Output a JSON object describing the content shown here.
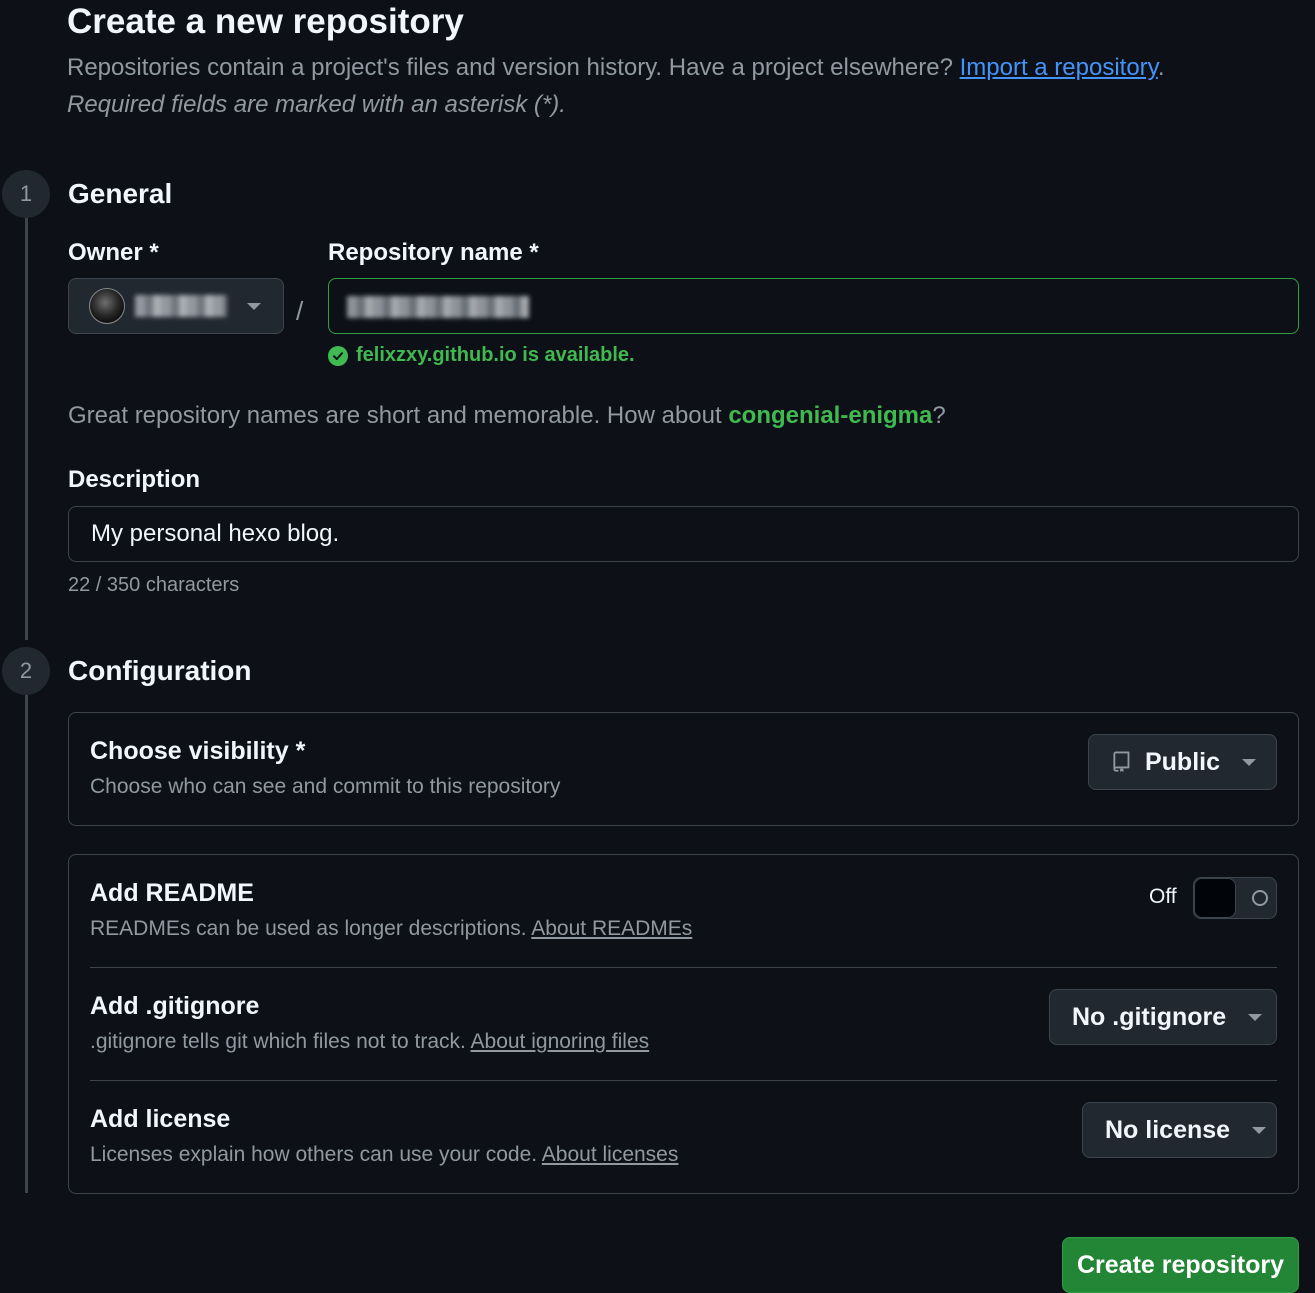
{
  "header": {
    "title": "Create a new repository",
    "subtitle_prefix": "Repositories contain a project's files and version history. Have a project elsewhere? ",
    "import_link": "Import a repository",
    "subtitle_suffix": ".",
    "required_note": "Required fields are marked with an asterisk (*)."
  },
  "steps": {
    "general": {
      "number": "1",
      "title": "General"
    },
    "configuration": {
      "number": "2",
      "title": "Configuration"
    }
  },
  "general": {
    "owner_label": "Owner *",
    "slash": "/",
    "repo_name_label": "Repository name *",
    "availability": "felixzxy.github.io is available.",
    "suggestion_prefix": "Great repository names are short and memorable. How about ",
    "suggestion_name": "congenial-enigma",
    "suggestion_suffix": "?",
    "description_label": "Description",
    "description_value": "My personal hexo blog.",
    "char_count": "22 / 350 characters"
  },
  "configuration": {
    "visibility": {
      "title": "Choose visibility *",
      "description": "Choose who can see and commit to this repository",
      "selected": "Public"
    },
    "readme": {
      "title": "Add README",
      "description": "READMEs can be used as longer descriptions. ",
      "link": "About READMEs",
      "toggle_state": "Off"
    },
    "gitignore": {
      "title": "Add .gitignore",
      "description": ".gitignore tells git which files not to track. ",
      "link": "About ignoring files",
      "selected": "No .gitignore"
    },
    "license": {
      "title": "Add license",
      "description": "Licenses explain how others can use your code. ",
      "link": "About licenses",
      "selected": "No license"
    }
  },
  "actions": {
    "create_label": "Create repository"
  },
  "colors": {
    "background": "#0d1117",
    "success": "#3fb950",
    "link": "#4493f8",
    "primary_button": "#238636"
  }
}
